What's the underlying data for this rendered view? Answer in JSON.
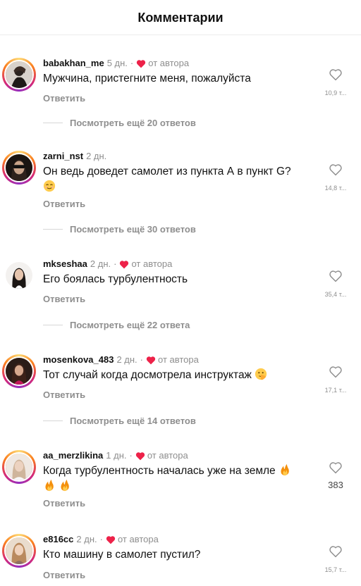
{
  "header": {
    "title": "Комментарии"
  },
  "common": {
    "reply_label": "Ответить"
  },
  "colors": {
    "accent_heart": "#ed2249",
    "muted": "#8e8e8e"
  },
  "comments": [
    {
      "username": "babakhan_me",
      "time": "5 дн.",
      "author_liked": true,
      "author_label": "от автора",
      "text": "Мужчина, пристегните меня, пожалуйста",
      "likes": "10,9 т...",
      "more_replies": "Посмотреть ещё 20 ответов"
    },
    {
      "username": "zarni_nst",
      "time": "2 дн.",
      "author_liked": false,
      "text": "Он ведь доведет самолет из пункта А в пункт G?",
      "emoji": "relieved-face-icon",
      "likes": "14,8 т...",
      "more_replies": "Посмотреть ещё 30 ответов"
    },
    {
      "username": "mkseshaa",
      "time": "2 дн.",
      "author_liked": true,
      "author_label": "от автора",
      "text": "Его боялась турбулентность",
      "likes": "35,4 т...",
      "more_replies": "Посмотреть ещё 22 ответа"
    },
    {
      "username": "mosenkova_483",
      "time": "2 дн.",
      "author_liked": true,
      "author_label": "от автора",
      "text": "Тот случай когда досмотрела инструктаж",
      "emoji": "face-with-peeking-hand-icon",
      "likes": "17,1 т...",
      "more_replies": "Посмотреть ещё 14 ответов"
    },
    {
      "username": "aa_merzlikina",
      "time": "1 дн.",
      "author_liked": true,
      "author_label": "от автора",
      "text": "Когда турбулентность началась уже на земле",
      "emoji": "fire-icon",
      "likes": "383"
    },
    {
      "username": "e816cc",
      "time": "2 дн.",
      "author_liked": true,
      "author_label": "от автора",
      "text": "Кто машину в самолет пустил?",
      "likes": "15,7 т..."
    }
  ]
}
